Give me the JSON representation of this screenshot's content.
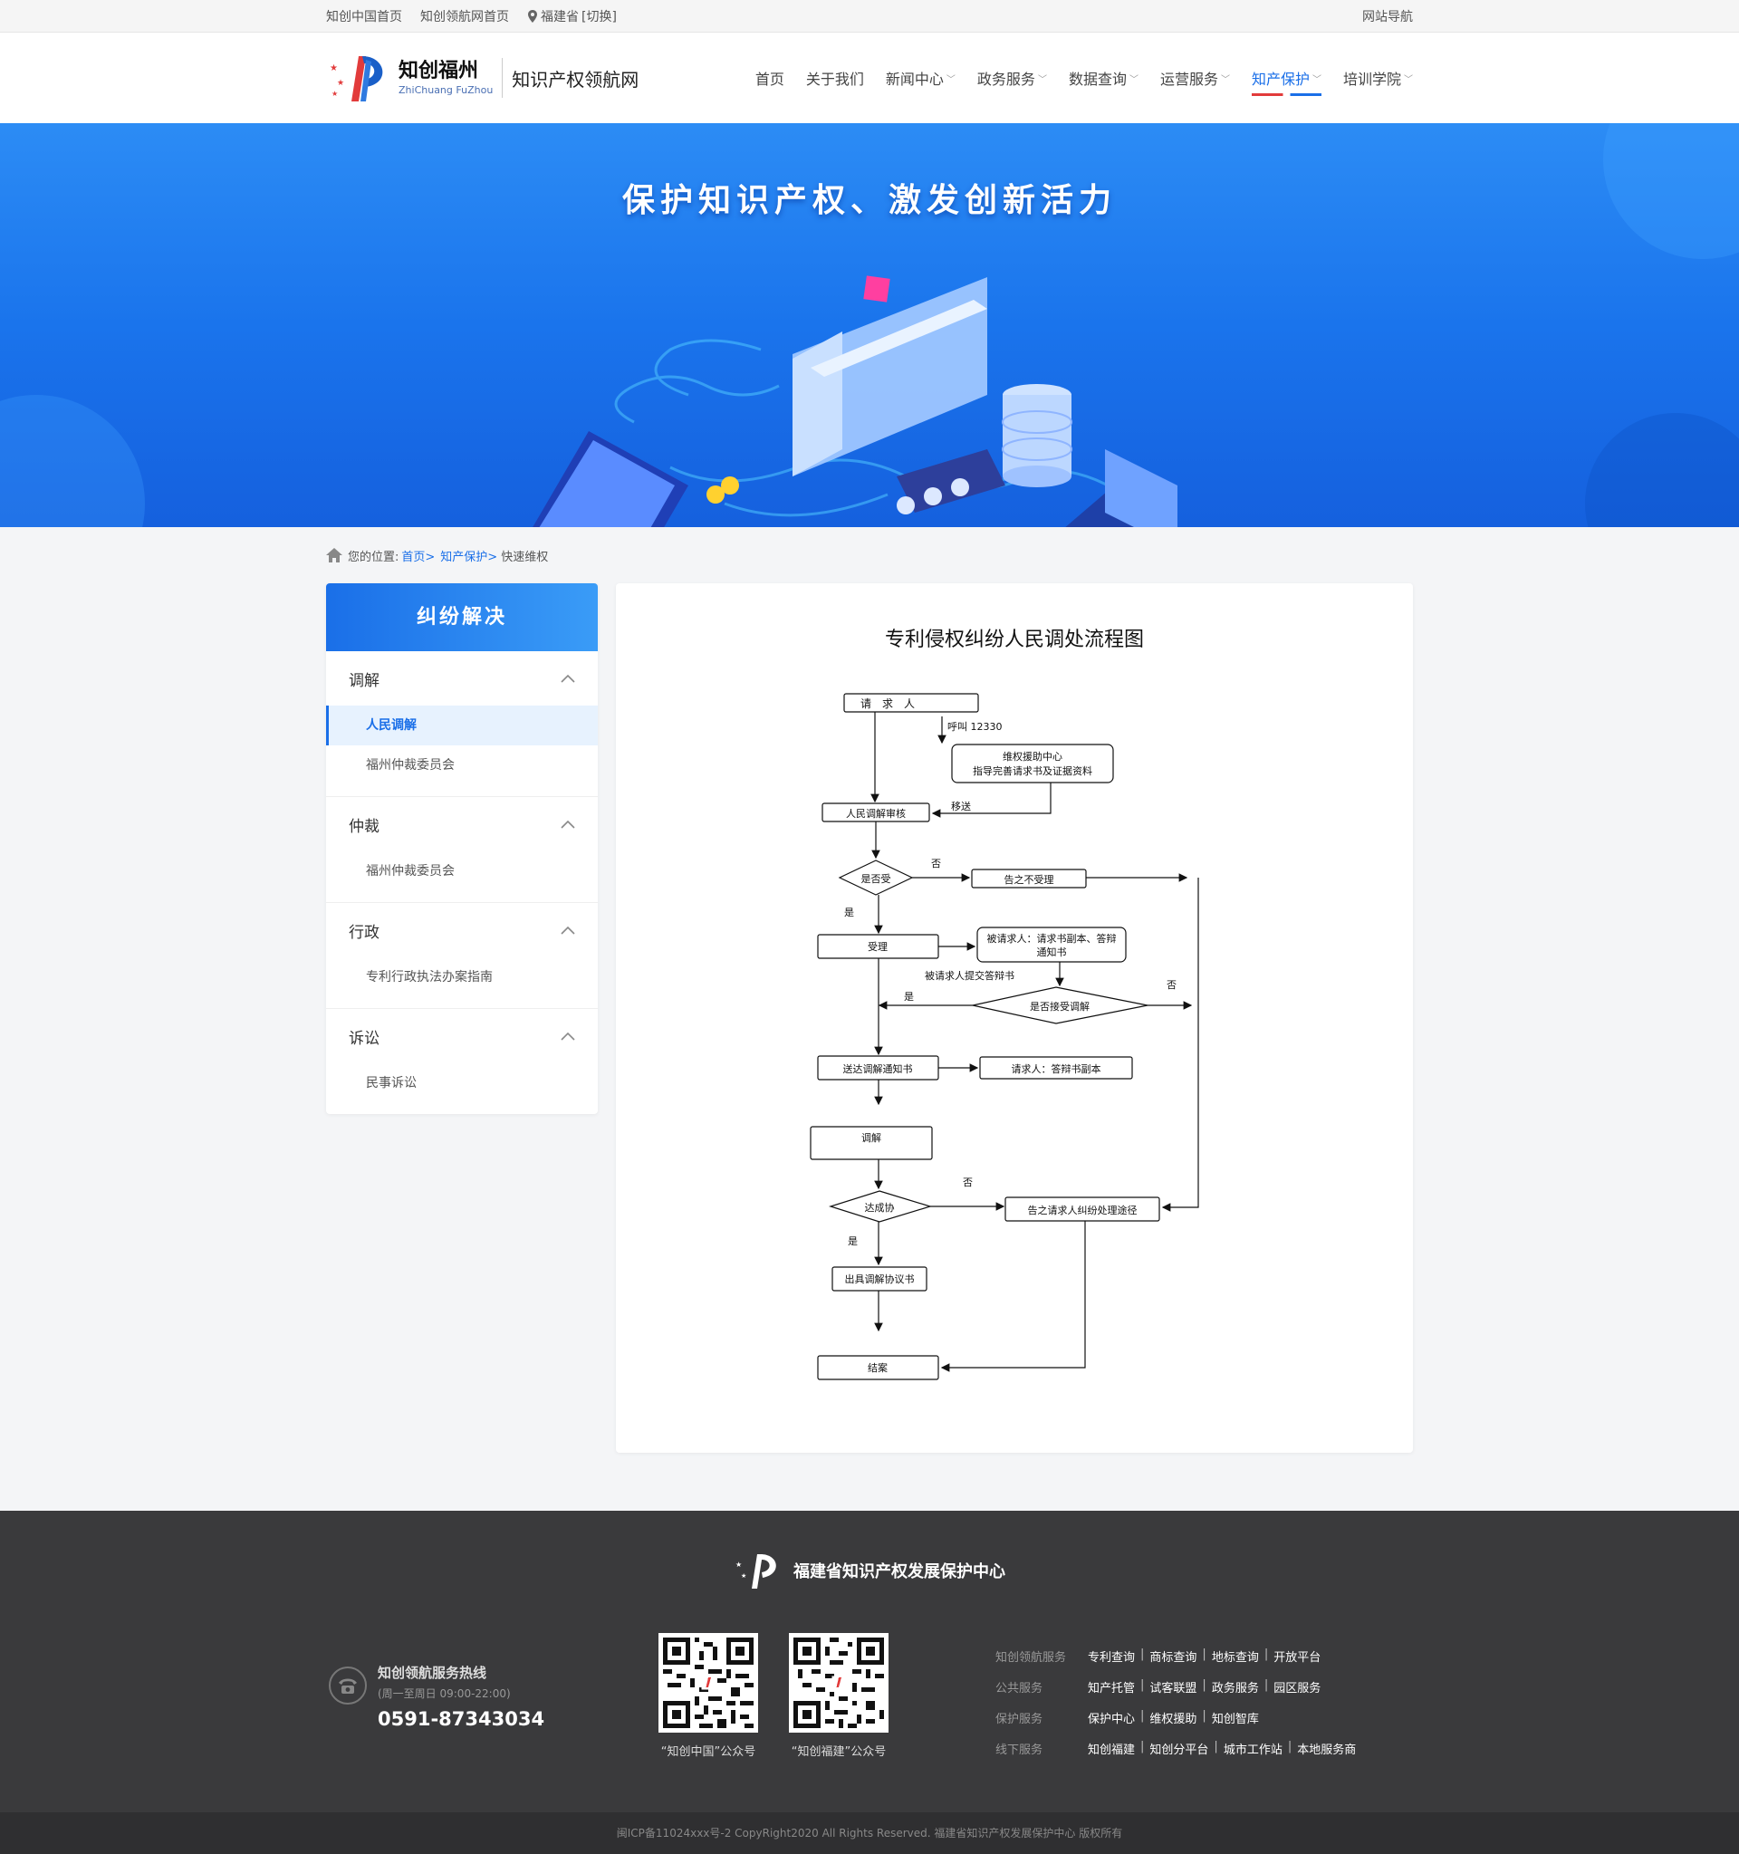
{
  "topbar": {
    "links": [
      "知创中国首页",
      "知创领航网首页"
    ],
    "location": "福建省",
    "switch": "[切换]",
    "site_nav": "网站导航"
  },
  "header": {
    "logo_cn": "知创福州",
    "logo_en": "ZhiChuang FuZhou",
    "site_name": "知识产权领航网"
  },
  "nav": [
    {
      "label": "首页",
      "dropdown": false
    },
    {
      "label": "关于我们",
      "dropdown": false
    },
    {
      "label": "新闻中心",
      "dropdown": true
    },
    {
      "label": "政务服务",
      "dropdown": true
    },
    {
      "label": "数据查询",
      "dropdown": true
    },
    {
      "label": "运营服务",
      "dropdown": true
    },
    {
      "label": "知产保护",
      "dropdown": true,
      "active": true
    },
    {
      "label": "培训学院",
      "dropdown": true
    }
  ],
  "banner": {
    "title": "保护知识产权、激发创新活力"
  },
  "breadcrumb": {
    "prefix": "您的位置:",
    "items": [
      "首页>",
      "知产保护>"
    ],
    "current": "快速维权"
  },
  "sidebar": {
    "title": "纠纷解决",
    "groups": [
      {
        "label": "调解",
        "items": [
          "人民调解",
          "福州仲裁委员会"
        ]
      },
      {
        "label": "仲裁",
        "items": [
          "福州仲裁委员会"
        ]
      },
      {
        "label": "行政",
        "items": [
          "专利行政执法办案指南"
        ]
      },
      {
        "label": "诉讼",
        "items": [
          "民事诉讼"
        ]
      }
    ],
    "selected": "人民调解"
  },
  "flowchart": {
    "title": "专利侵权纠纷人民调处流程图",
    "nodes": {
      "requester": "请　求　人",
      "call": "呼叫 12330",
      "center_1": "维权援助中心",
      "center_2": "指导完善请求书及证据资料",
      "transfer": "移送",
      "review": "人民调解审核",
      "accept_q": "是否受",
      "no1": "否",
      "reject": "告之不受理",
      "yes1": "是",
      "accept": "受理",
      "respondent_1": "被请求人：请求书副本、答辩",
      "respondent_2": "通知书",
      "submit_reply": "被请求人提交答辩书",
      "yes2": "是",
      "mediate_q": "是否接受调解",
      "no2": "否",
      "notice": "送达调解通知书",
      "requester_copy": "请求人：答辩书副本",
      "mediation": "调解",
      "agree_q": "达成协",
      "no3": "否",
      "other_way": "告之请求人纠纷处理途径",
      "yes3": "是",
      "agreement": "出具调解协议书",
      "close": "结案"
    }
  },
  "footer": {
    "org": "福建省知识产权发展保护中心",
    "hotline_title": "知创领航服务热线",
    "hotline_hours": "(周一至周日 09:00-22:00)",
    "hotline_phone": "0591-87343034",
    "qr": [
      "“知创中国”公众号",
      "“知创福建”公众号"
    ],
    "link_rows": [
      {
        "label": "知创领航服务",
        "items": [
          "专利查询",
          "商标查询",
          "地标查询",
          "开放平台"
        ]
      },
      {
        "label": "公共服务",
        "items": [
          "知产托管",
          "试客联盟",
          "政务服务",
          "园区服务"
        ]
      },
      {
        "label": "保护服务",
        "items": [
          "保护中心",
          "维权援助",
          "知创智库"
        ]
      },
      {
        "label": "线下服务",
        "items": [
          "知创福建",
          "知创分平台",
          "城市工作站",
          "本地服务商"
        ]
      }
    ],
    "copyright": "闽ICP备11024xxx号-2  CopyRight2020  All Rights Reserved.  福建省知识产权发展保护中心  版权所有"
  },
  "colors": {
    "primary": "#1a6fe8",
    "accent_red": "#e23b3b",
    "footer_bg": "#3a3a3c"
  }
}
